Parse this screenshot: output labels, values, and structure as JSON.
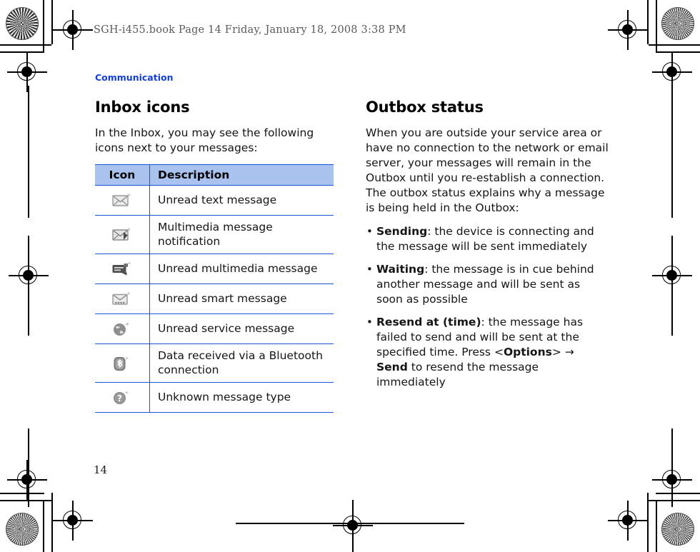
{
  "print_header": {
    "text": "SGH-i455.book  Page 14  Friday, January 18, 2008  3:38 PM"
  },
  "chapter_label": "Communication",
  "folio": "14",
  "left_column": {
    "heading": "Inbox icons",
    "intro": "In the Inbox, you may see the following icons next to your messages:",
    "table": {
      "headers": [
        "Icon",
        "Description"
      ],
      "rows": [
        {
          "icon": "unread-text-message-icon",
          "description": "Unread text message"
        },
        {
          "icon": "multimedia-message-notification-icon",
          "description": "Multimedia message notification"
        },
        {
          "icon": "unread-multimedia-message-icon",
          "description": "Unread multimedia message"
        },
        {
          "icon": "unread-smart-message-icon",
          "description": "Unread smart message"
        },
        {
          "icon": "unread-service-message-icon",
          "description": "Unread service message"
        },
        {
          "icon": "bluetooth-data-received-icon",
          "description": "Data received via a Bluetooth connection"
        },
        {
          "icon": "unknown-message-type-icon",
          "description": "Unknown message type"
        }
      ]
    }
  },
  "right_column": {
    "heading": "Outbox status",
    "intro": "When you are outside your service area or have no connection to the network or email server, your messages will remain in the Outbox until you re-establish a connection. The outbox status explains why a message is being held in the Outbox:",
    "bullets": [
      {
        "term": "Sending",
        "rest": ": the device is connecting and the message will be sent immediately"
      },
      {
        "term": "Waiting",
        "rest": ": the message is in cue behind another message and will be sent as soon as possible"
      },
      {
        "term": "Resend at (time)",
        "rest_1": ": the message has failed to send and will be sent at the specified time. Press ",
        "key_1": "<Options>",
        "arrow": " → ",
        "key_2": "Send",
        "rest_2": " to resend the message immediately"
      }
    ]
  },
  "colors": {
    "chapter_label": "#1240d8",
    "table_header_bg": "#a9c2ee",
    "table_border": "#1a54d8",
    "body_text": "#151515"
  }
}
